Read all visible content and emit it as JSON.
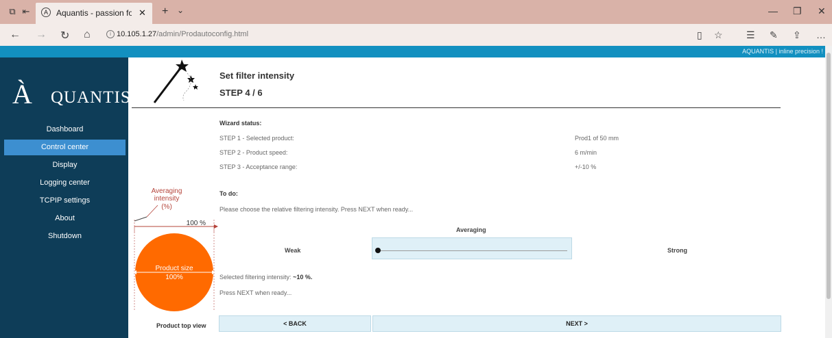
{
  "browser": {
    "tab_title": "Aquantis - passion for p",
    "url_host": "10.105.1.27",
    "url_path": "/admin/Prodautoconfig.html"
  },
  "header": {
    "tagline": "AQUANTIS | inline precision !"
  },
  "logo": {
    "big": "À",
    "rest": "QUANTIS"
  },
  "sidebar": {
    "items": [
      {
        "label": "Dashboard"
      },
      {
        "label": "Control center"
      },
      {
        "label": "Display"
      },
      {
        "label": "Logging center"
      },
      {
        "label": "TCPIP settings"
      },
      {
        "label": "About"
      },
      {
        "label": "Shutdown"
      }
    ]
  },
  "main": {
    "title": "Set filter intensity",
    "step": "STEP 4 / 6",
    "wizard_status_label": "Wizard status:",
    "steps": [
      {
        "label": "STEP 1 - Selected product:",
        "value": "Prod1 of 50 mm"
      },
      {
        "label": "STEP 2 - Product speed:",
        "value": "6 m/min"
      },
      {
        "label": "STEP 3 - Acceptance range:",
        "value": "+/-10 %"
      }
    ],
    "todo_label": "To do:",
    "todo_text": "Please choose the relative filtering intensity. Press NEXT when ready...",
    "slider_title": "Averaging",
    "weak": "Weak",
    "strong": "Strong",
    "slider_level": 0.0,
    "selected_prefix": "Selected filtering intensity: ",
    "selected_value": "~10 %.",
    "press_next": "Press NEXT when ready...",
    "back_label": "< BACK",
    "next_label": "NEXT >"
  },
  "illustration": {
    "averaging_line1": "Averaging",
    "averaging_line2": "intensity",
    "averaging_line3": "(%)",
    "percent": "100 %",
    "product_size": "Product size",
    "product_pct": "100%",
    "caption": "Product top view"
  },
  "colors": {
    "sidebar": "#0e3d58",
    "accent": "#1290c0",
    "active": "#3d8fd0",
    "orange": "#ff6a00",
    "button_bg": "#dff0f7"
  }
}
